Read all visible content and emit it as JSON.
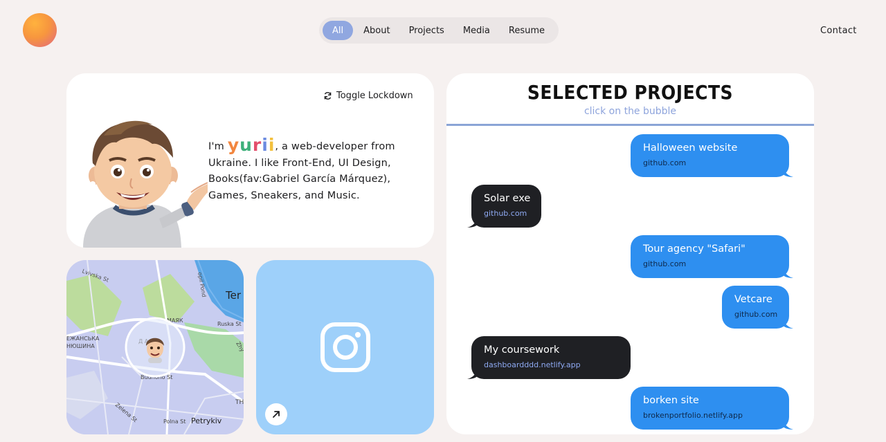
{
  "nav": {
    "tabs": [
      {
        "label": "All",
        "active": true
      },
      {
        "label": "About",
        "active": false
      },
      {
        "label": "Projects",
        "active": false
      },
      {
        "label": "Media",
        "active": false
      },
      {
        "label": "Resume",
        "active": false
      }
    ],
    "contact_label": "Contact"
  },
  "about": {
    "toggle_label": "Toggle Lockdown",
    "bio_prefix": "I'm",
    "name_letters": [
      "y",
      "u",
      "r",
      "i",
      "i"
    ],
    "bio_rest": ", a web-developer from Ukraine. I like Front-End, UI Design, Books(fav:Gabriel García Márquez), Games, Sneakers, and Music."
  },
  "map": {
    "labels": {
      "street1": "Lvivska St",
      "street2": "Ruska St",
      "street3": "Budnoho St",
      "street4": "Zelena St",
      "street5": "Polna St",
      "street6": "Zhy",
      "pond": "opil Pond",
      "city_cut": "Ter",
      "district1": "МАЯК",
      "district2": "ЕЖАНСЬКА",
      "district3": "НЮШИНА",
      "district4": "Д А",
      "district5": "Petrykiv",
      "district6": "ТН"
    }
  },
  "projects": {
    "title": "SELECTED PROJECTS",
    "subtitle": "click on the bubble",
    "bubbles": [
      {
        "title": "Halloween website",
        "link": "github.com",
        "side": "right"
      },
      {
        "title": "Solar exe",
        "link": "github.com",
        "side": "left"
      },
      {
        "title": "Tour agency \"Safari\"",
        "link": "github.com",
        "side": "right"
      },
      {
        "title": "Vetcare",
        "link": "github.com",
        "side": "right"
      },
      {
        "title": "My coursework",
        "link": "dashboardddd.netlify.app",
        "side": "left"
      },
      {
        "title": "borken site",
        "link": "brokenportfolio.netlify.app",
        "side": "right"
      }
    ]
  },
  "colors": {
    "accent": "#90a7e0",
    "bubble_blue": "#2e8ff0",
    "bubble_dark": "#1f2024",
    "instagram_bg": "#9ed0fa"
  },
  "icons": {
    "toggle": "refresh-icon",
    "instagram": "instagram-icon",
    "arrow": "arrow-up-right-icon"
  }
}
